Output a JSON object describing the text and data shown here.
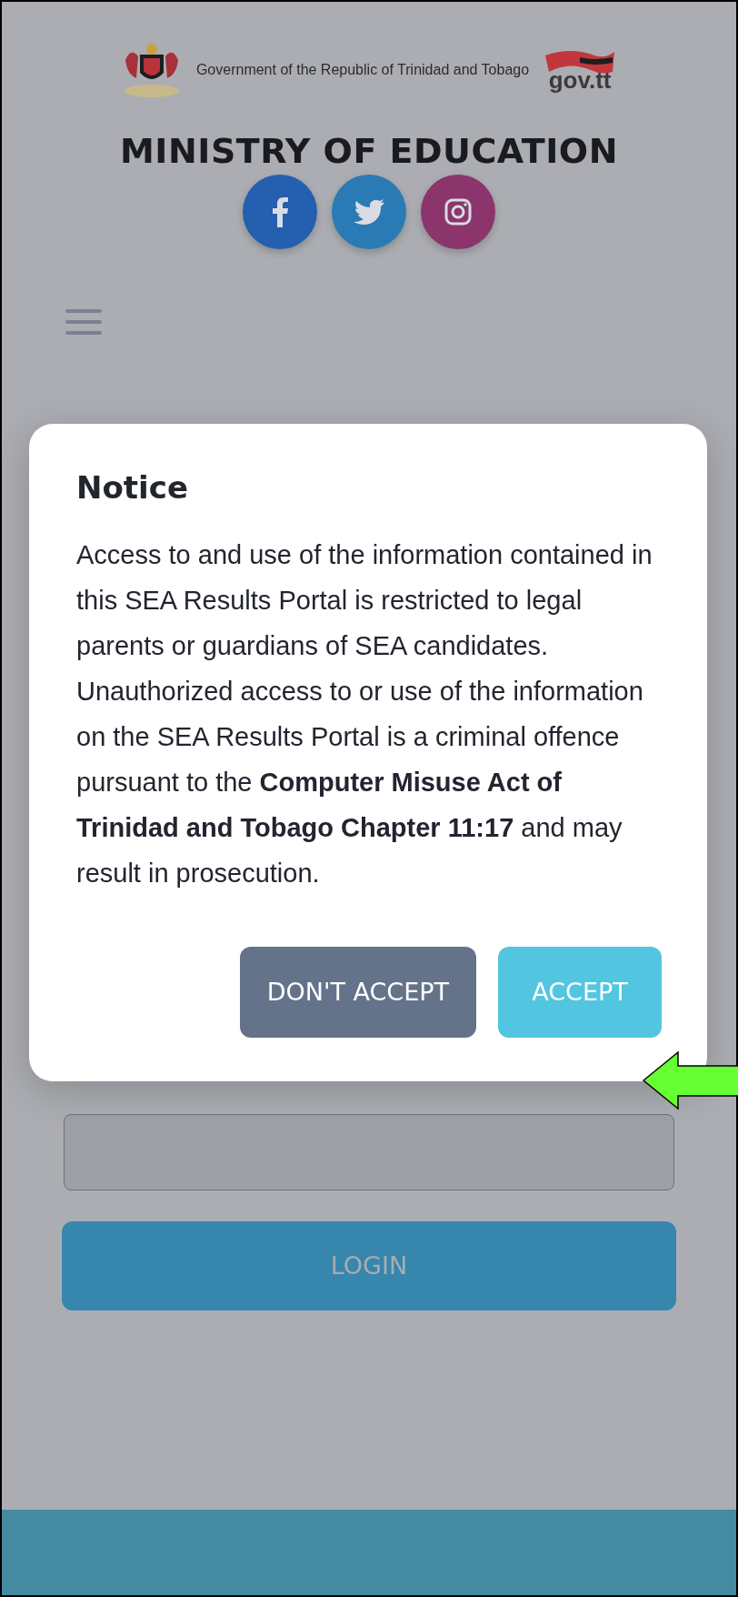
{
  "header": {
    "government_text": "Government of the Republic of Trinidad and Tobago",
    "logo_text": "gov.tt",
    "ministry_title": "MINISTRY OF EDUCATION"
  },
  "login_button": {
    "label": "LOGIN"
  },
  "modal": {
    "title": "Notice",
    "body": "Access to and use of the information contained in this SEA Results Portal is restricted to legal parents or guardians of SEA candidates. Unauthorized access to or use of the information on the SEA Results Portal is a criminal offence pursuant to the **Computer Misuse Act of Trinidad and Tobago Chapter 11:17** and may result in prosecution.",
    "buttons": [
      {
        "label": "DON'T ACCEPT",
        "kind": "secondary"
      },
      {
        "label": "ACCEPT",
        "kind": "primary"
      }
    ]
  }
}
